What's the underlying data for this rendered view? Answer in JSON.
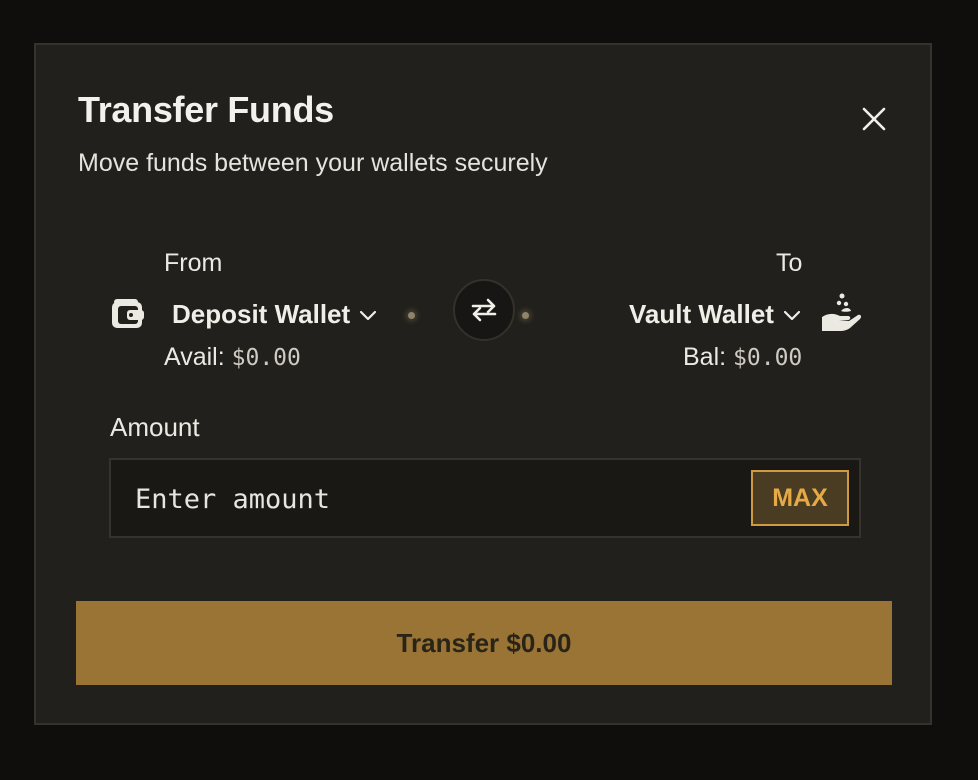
{
  "modal": {
    "title": "Transfer Funds",
    "subtitle": "Move funds between your wallets securely",
    "close_icon": "close-icon"
  },
  "from": {
    "label": "From",
    "wallet": "Deposit Wallet",
    "icon": "wallet-icon",
    "balance_label": "Avail:",
    "balance_value": "$0.00"
  },
  "to": {
    "label": "To",
    "wallet": "Vault Wallet",
    "icon": "hand-coin-icon",
    "balance_label": "Bal:",
    "balance_value": "$0.00"
  },
  "swap": {
    "icon": "swap-arrows-icon"
  },
  "amount": {
    "label": "Amount",
    "placeholder": "Enter amount",
    "value": "",
    "max_label": "MAX"
  },
  "submit": {
    "label": "Transfer $0.00"
  },
  "colors": {
    "accent": "#9a7434",
    "max_border": "#d09a42",
    "modal_bg": "#22201c",
    "backdrop": "#0f0e0c"
  }
}
